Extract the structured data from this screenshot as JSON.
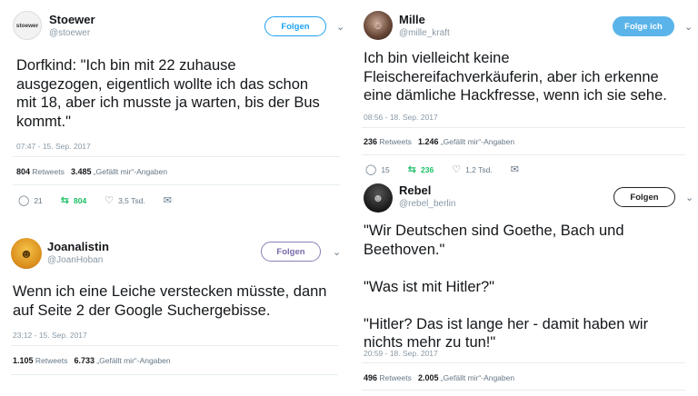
{
  "tweets": [
    {
      "name": "Stoewer",
      "handle": "@stoewer",
      "avatar_text": "stoewer",
      "follow_label": "Folgen",
      "text": "Dorfkind: \"Ich bin mit 22 zuhause\nausgezogen, eigentlich wollte ich das schon\nmit 18, aber ich musste ja warten, bis der Bus\nkommt.\"",
      "timestamp": "07:47 - 15. Sep. 2017",
      "retweets_count": "804",
      "retweets_label": "Retweets",
      "likes_count": "3.485",
      "likes_label": "„Gefällt mir“-Angaben",
      "reply_count": "21",
      "retweet_count": "804",
      "like_count": "3,5 Tsd."
    },
    {
      "name": "Joanalistin",
      "handle": "@JoanHoban",
      "follow_label": "Folgen",
      "text": "Wenn ich eine Leiche verstecken müsste, dann\nauf Seite 2 der Google Suchergebisse.",
      "timestamp": "23:12 - 15. Sep. 2017",
      "retweets_count": "1.105",
      "retweets_label": "Retweets",
      "likes_count": "6.733",
      "likes_label": "„Gefällt mir“-Angaben"
    },
    {
      "name": "Mille",
      "handle": "@mille_kraft",
      "follow_label": "Folge ich",
      "text": "Ich bin vielleicht keine\nFleischereifachverkäuferin, aber ich erkenne\neine dämliche Hackfresse, wenn ich sie sehe.",
      "timestamp": "08:56 - 18. Sep. 2017",
      "retweets_count": "236",
      "retweets_label": "Retweets",
      "likes_count": "1.246",
      "likes_label": "„Gefällt mir“-Angaben",
      "reply_count": "15",
      "retweet_count": "236",
      "like_count": "1,2 Tsd."
    },
    {
      "name": "Rebel",
      "handle": "@rebel_berlin",
      "follow_label": "Folgen",
      "text": "\"Wir Deutschen sind Goethe, Bach und\nBeethoven.\"\n\n\"Was ist mit Hitler?\"\n\n\"Hitler? Das ist lange her - damit haben wir\nnichts mehr zu tun!\"",
      "timestamp": "20:59 - 18. Sep. 2017",
      "retweets_count": "496",
      "retweets_label": "Retweets",
      "likes_count": "2.005",
      "likes_label": "„Gefällt mir“-Angaben"
    }
  ],
  "icons": {
    "reply": "reply-icon",
    "retweet": "retweet-icon",
    "like": "heart-icon",
    "dm": "envelope-icon",
    "more": "chevron-down-icon"
  },
  "colors": {
    "follow_blue": "#1da1f2",
    "retweet_green": "#17bf63",
    "muted": "#8899a6"
  }
}
